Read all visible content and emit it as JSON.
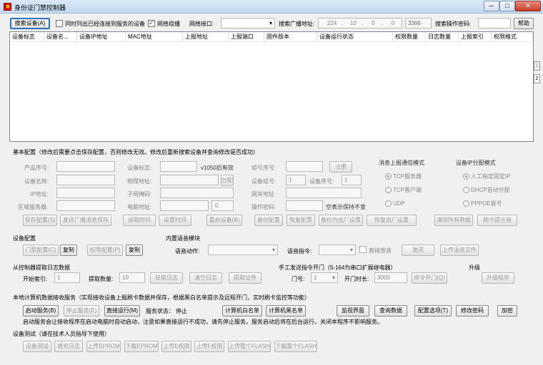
{
  "window": {
    "title": "身份证门禁控制器",
    "min": "─",
    "max": "□",
    "close": "✕"
  },
  "toolbar": {
    "search_btn": "搜索设备(A)",
    "only_connected": "同时列出已经连接到服务的设备",
    "net_group": "网络组播",
    "net_if_label": "网络接口:",
    "net_if_value": "",
    "bcast_label": "搜索广播地址:",
    "bcast_ip": [
      "224",
      ".",
      "10",
      ".",
      "0",
      ".",
      "0"
    ],
    "port": "3366",
    "pwd_label": "搜索操作密码:",
    "pwd_value": "",
    "help": "帮助"
  },
  "grid": {
    "columns": [
      "设备标志",
      "设备名...",
      "设备IP地址",
      "MAC地址",
      "上报地址",
      "上报端口",
      "固件版本",
      "设备运行状态",
      "权限数量",
      "日志数量",
      "上报索引",
      "权限格式"
    ],
    "tabs": [
      "1",
      "2"
    ]
  },
  "basic": {
    "title": "基本配置（修改后需要点击保存配置，否则修改无效。修改后重新搜索设备并查询修改是否成功）",
    "product_sn": "产品序号:",
    "device_name": "设备名称:",
    "ip": "IP地址:",
    "zone_server": "区域服务器:",
    "device_flag": "设备标志:",
    "flag_note": "v1050后有效",
    "phys_addr": "物理地址:",
    "assign": "分配",
    "subnet": "子网掩码:",
    "pc_addr": "电脑地址:",
    "pc_addr_val": "0",
    "group_sn": "组号序号:",
    "register": "注册",
    "device_group": "设备组号:",
    "device_group_val": "1",
    "device_seq": "设备序号:",
    "device_seq_val": "1",
    "gateway": "网关地址:",
    "op_pwd": "操作密码:",
    "keep_note": "空表示保持不变",
    "report_mode_title": "消息上报通信模式",
    "report_modes": [
      "TCP服务器",
      "TCP客户端",
      "UDP"
    ],
    "ip_mode_title": "设备IP分配模式",
    "ip_modes": [
      "人工指定固定IP",
      "DHCP自动分配",
      "PPPOE拨号"
    ],
    "actions": [
      "保存配置(S)",
      "发送广播消息保存",
      "读取时间",
      "设置时间",
      "重启设备(B)",
      "备份配置",
      "恢复配置",
      "备份为出厂设置",
      "恢复出厂设置",
      "清除所有数据",
      "刷卡提示音"
    ]
  },
  "devcfg": {
    "title": "设备配置",
    "door_cfg": "门禁配置(C)",
    "copy": "复制",
    "perm_cfg": "权限配置(P)",
    "copy2": "复制"
  },
  "voice": {
    "title": "内置语音模块",
    "action_label": "语音动作:",
    "action_val": "",
    "cmd_label": "语音指令:",
    "cmd_val": "",
    "direct": "直接放音",
    "send": "发送",
    "upload": "上传语音文件"
  },
  "logfetch": {
    "title": "从控制器提取日志数据",
    "start_label": "开始索引:",
    "start_val": "1",
    "count_label": "提取数量:",
    "count_val": "10",
    "fetch": "获取日志",
    "clear": "清空日志",
    "fetch_cert": "提取证件"
  },
  "manual": {
    "title": "手工发送指令开门（5-164为串口扩展继电器）",
    "door_label": "门号:",
    "door_val": "1",
    "dur_label": "开门时长:",
    "dur_val": "3000",
    "cmd": "命令开门(Q)"
  },
  "upgrade": {
    "title": "升级",
    "btn": "升级程序"
  },
  "service": {
    "title": "本地计算机数据接收服务（实现接收设备上报刷卡数据并保存，根据黑白名单提示及远程开门，实时刷卡监控等功能）",
    "start": "启动服务(B)",
    "stop": "停止服务(E)",
    "run": "直接运行(M)",
    "status_label": "服务状态：",
    "status": "停止",
    "whitelist": "计算机白名单",
    "blacklist": "计算机黑名单",
    "monitor": "监视界面",
    "query": "查询数据",
    "options": "配置选项(T)",
    "changepwd": "修改密码",
    "encrypt": "加密",
    "note": "启动服务会让接收程序在启动电脑时自动启动，注意如果直接运行不成功，请先停止服务。服务启动后将在后台运行，关闭本程序不影响服务。"
  },
  "test": {
    "title": "设备测试（请在技术人员指导下使用）",
    "btns": [
      "设备测试",
      "填充日志",
      "上传EPROM",
      "下载EPROM",
      "上传E权限",
      "上传F权限",
      "上传整个FLASH",
      "下载整个FLASH"
    ]
  }
}
